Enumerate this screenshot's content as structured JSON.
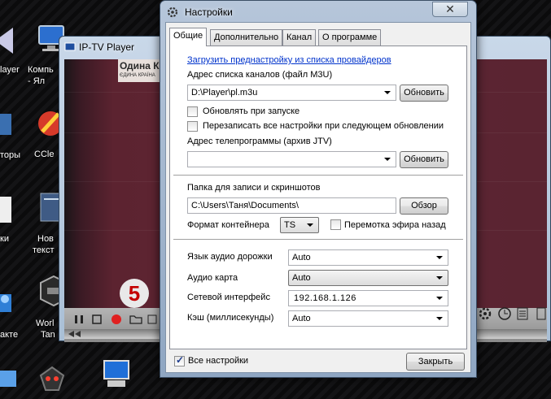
{
  "desktop": {
    "labels": {
      "player_partial": "layer",
      "computer_l1": "Компь",
      "computer_l2": "- Ял",
      "utilities_partial": "торы",
      "ccleaner": "CCle",
      "links_partial": "ки",
      "new_l1": "Нов",
      "new_l2": "текст",
      "contacts_partial": "акте",
      "wot_l1": "Worl",
      "wot_l2": "Tan"
    }
  },
  "player": {
    "title": "IP-TV Player",
    "logo_text": "Одина К",
    "logo_sub": "ЄДИНА КРАЇНА",
    "channel_number": "5"
  },
  "dialog": {
    "title": "Настройки",
    "close_glyph": "✕",
    "tabs": [
      "Общие",
      "Дополнительно",
      "Канал",
      "О программе"
    ],
    "active_tab": "Общие",
    "provider_link": "Загрузить преднастройку из списка провайдеров",
    "playlist_label": "Адрес списка каналов (файл M3U)",
    "playlist_value": "D:\\Player\\pl.m3u",
    "refresh_button": "Обновить",
    "update_on_start": {
      "label": "Обновлять при запуске",
      "checked": false
    },
    "overwrite_settings": {
      "label": "Перезаписать все настройки при следующем обновлении",
      "checked": false
    },
    "epg_label": "Адрес телепрограммы (архив JTV)",
    "epg_value": "",
    "epg_refresh_button": "Обновить",
    "record_folder_label": "Папка для записи и скриншотов",
    "record_folder_value": "C:\\Users\\Таня\\Documents\\",
    "browse_button": "Обзор",
    "container_label": "Формат контейнера",
    "container_value": "TS",
    "timeshift": {
      "label": "Перемотка эфира назад",
      "checked": false
    },
    "audio_track_label": "Язык аудио дорожки",
    "audio_track_value": "Auto",
    "audio_card_label": "Аудио карта",
    "audio_card_value": "Auto",
    "network_label": "Сетевой интерфейс",
    "network_value": "192.168.1.126",
    "cache_label": "Кэш (миллисекунды)",
    "cache_value": "Auto",
    "all_settings": {
      "label": "Все настройки",
      "checked": true
    },
    "close_button": "Закрыть"
  }
}
